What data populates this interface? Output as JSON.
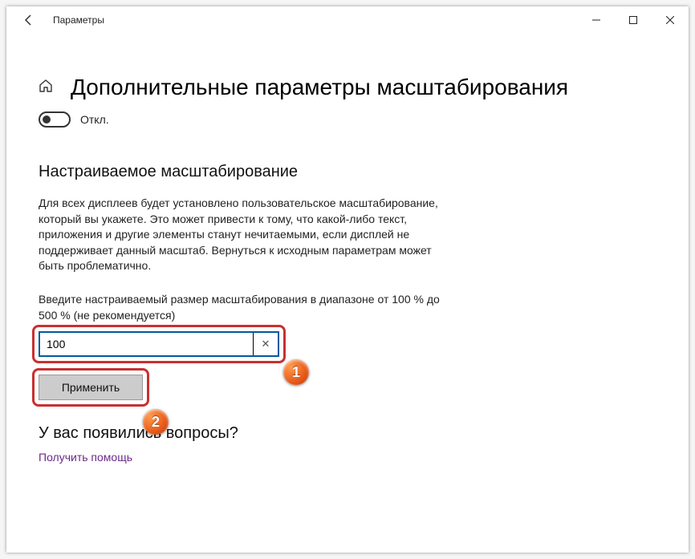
{
  "titlebar": {
    "title": "Параметры"
  },
  "page": {
    "title": "Дополнительные параметры масштабирования"
  },
  "toggle": {
    "state_label": "Откл."
  },
  "section": {
    "heading": "Настраиваемое масштабирование",
    "description": "Для всех дисплеев будет установлено пользовательское масштабирование, который вы укажете. Это может привести к тому, что какой-либо текст, приложения и другие элементы станут нечитаемыми, если дисплей не поддерживает данный масштаб. Вернуться к исходным параметрам может быть проблематично.",
    "input_label": "Введите настраиваемый размер масштабирования в диапазоне от 100 % до 500 % (не рекомендуется)",
    "input_value": "100",
    "apply_label": "Применить"
  },
  "help": {
    "heading": "У вас появились вопросы?",
    "link": "Получить помощь"
  },
  "annotations": {
    "badge1": "1",
    "badge2": "2"
  }
}
